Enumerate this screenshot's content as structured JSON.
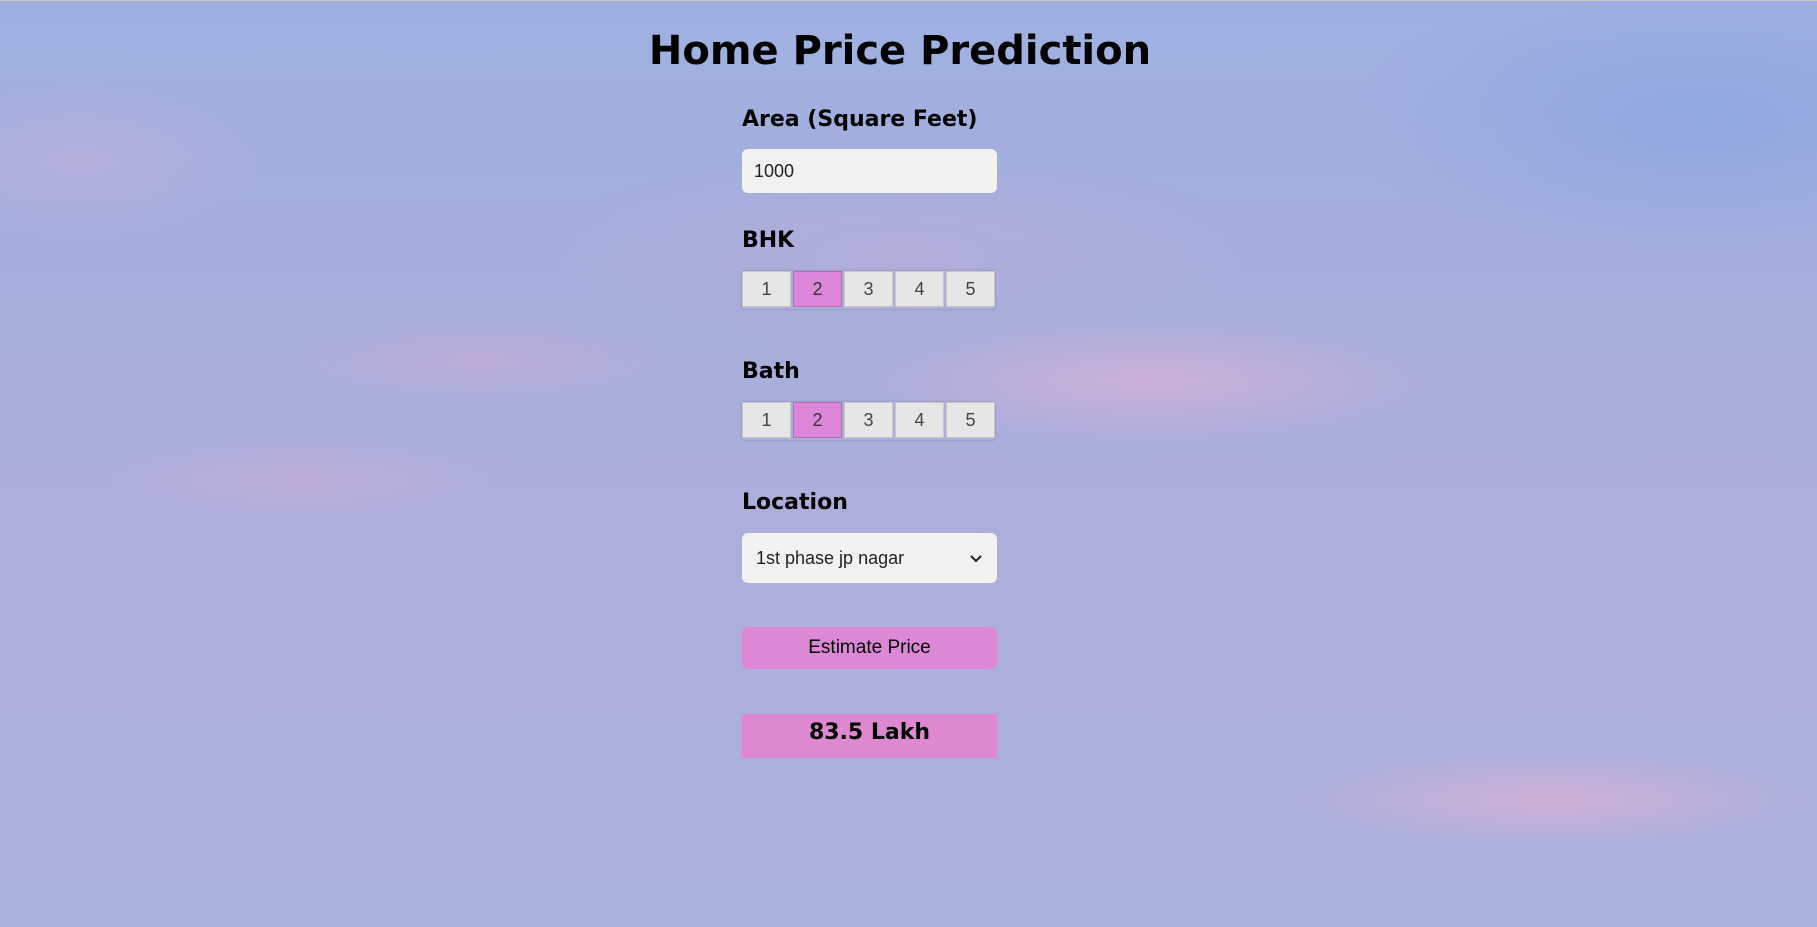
{
  "page": {
    "title": "Home Price Prediction"
  },
  "area": {
    "label": "Area (Square Feet)",
    "value": "1000"
  },
  "bhk": {
    "label": "BHK",
    "options": [
      "1",
      "2",
      "3",
      "4",
      "5"
    ],
    "selected": "2"
  },
  "bath": {
    "label": "Bath",
    "options": [
      "1",
      "2",
      "3",
      "4",
      "5"
    ],
    "selected": "2"
  },
  "location": {
    "label": "Location",
    "selected": "1st phase jp nagar"
  },
  "estimate": {
    "button_label": "Estimate Price",
    "result": "83.5 Lakh"
  },
  "colors": {
    "accent": "#dd88d6",
    "input_bg": "#f2f2f2",
    "option_bg": "#e6e6e6"
  },
  "icons": {
    "select_arrow": "chevron-down-icon"
  }
}
